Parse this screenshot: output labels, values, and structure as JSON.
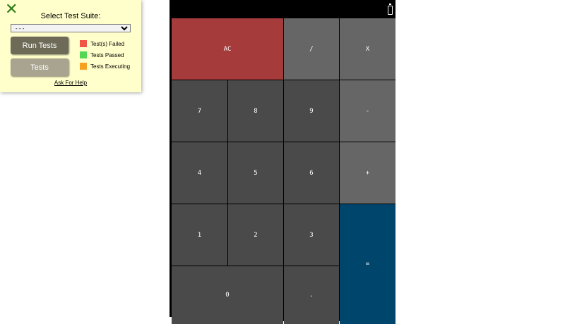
{
  "panel": {
    "close_glyph": "✕",
    "suite_label": "Select Test Suite:",
    "suite_selected": "- - -",
    "run_label": "Run Tests",
    "tests_label": "Tests",
    "legend": [
      {
        "label": "Test(s) Failed",
        "color": "#f05545"
      },
      {
        "label": "Tests Passed",
        "color": "#55d655"
      },
      {
        "label": "Tests Executing",
        "color": "#f5a020"
      }
    ],
    "help_label": "Ask For Help"
  },
  "calculator": {
    "keys": {
      "ac": "AC",
      "divide": "/",
      "multiply": "X",
      "seven": "7",
      "eight": "8",
      "nine": "9",
      "minus": "-",
      "four": "4",
      "five": "5",
      "six": "6",
      "plus": "+",
      "one": "1",
      "two": "2",
      "three": "3",
      "equals": "=",
      "zero": "0",
      "dot": "."
    }
  },
  "colors": {
    "panel_bg": "#ffffcc",
    "clear_key": "#a63b3c",
    "equals_key": "#00456b",
    "operator_key": "#666666",
    "digit_key": "#4a4a4a"
  }
}
